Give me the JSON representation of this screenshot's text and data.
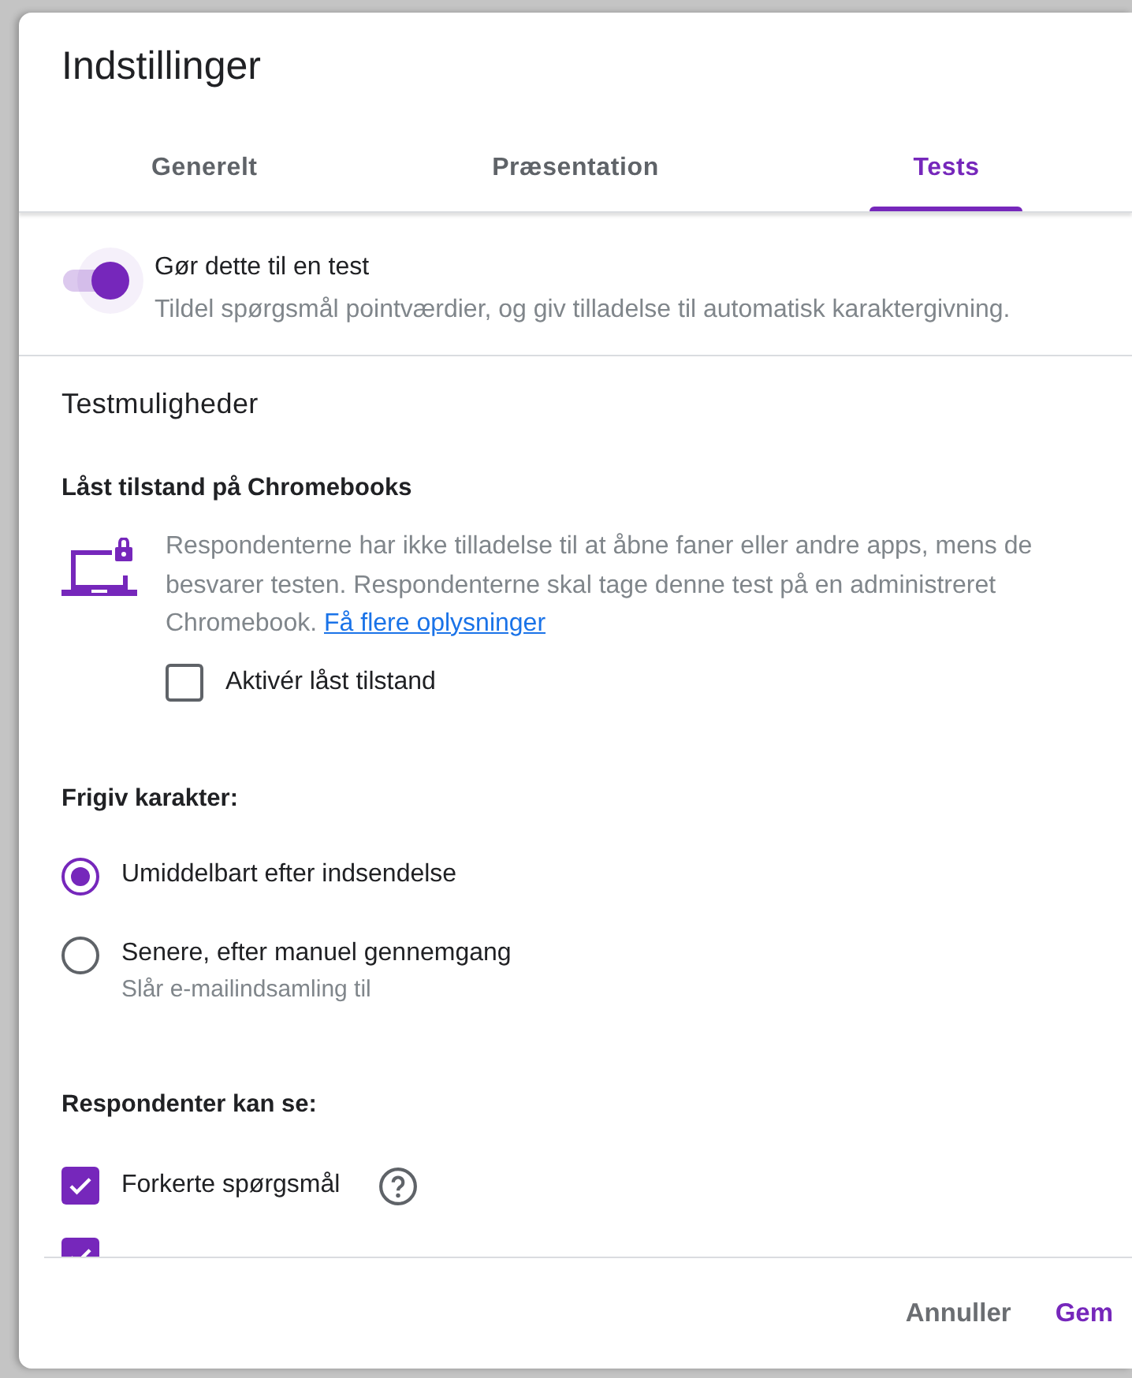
{
  "dialog": {
    "title": "Indstillinger"
  },
  "tabs": [
    {
      "label": "Generelt",
      "selected": false
    },
    {
      "label": "Præsentation",
      "selected": false
    },
    {
      "label": "Tests",
      "selected": true
    }
  ],
  "quiz_toggle": {
    "label": "Gør dette til en test",
    "description": "Tildel spørgsmål pointværdier, og giv tilladelse til automatisk karaktergivning.",
    "on": true
  },
  "section_title": "Testmuligheder",
  "locked_mode": {
    "heading": "Låst tilstand på Chromebooks",
    "description": "Respondenterne har ikke tilladelse til at åbne faner eller andre apps, mens de besvarer testen. Respondenterne skal tage denne test på en administreret Chromebook.",
    "link": "Få flere oplysninger",
    "checkbox": {
      "label": "Aktivér låst tilstand",
      "checked": false
    }
  },
  "release_grade": {
    "heading": "Frigiv karakter:",
    "options": [
      {
        "label": "Umiddelbart efter indsendelse",
        "selected": true
      },
      {
        "label": "Senere, efter manuel gennemgang",
        "note": "Slår e-mailindsamling til",
        "selected": false
      }
    ]
  },
  "respondents_see": {
    "heading": "Respondenter kan se:",
    "items": [
      {
        "label": "Forkerte spørgsmål",
        "checked": true
      },
      {
        "checked": true
      }
    ]
  },
  "footer": {
    "buttons": [
      {
        "label": "Annuller",
        "kind": "cancel"
      },
      {
        "label": "Gem",
        "kind": "primary"
      }
    ]
  }
}
